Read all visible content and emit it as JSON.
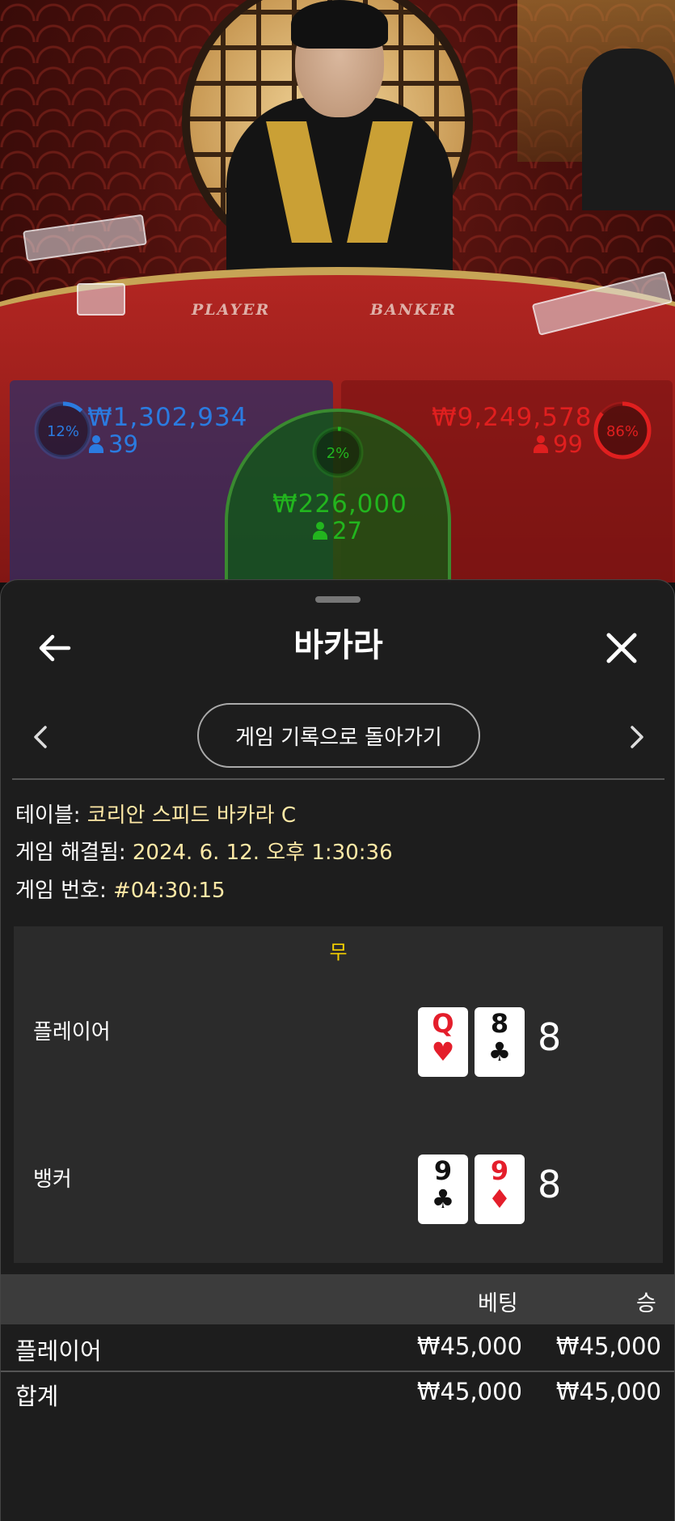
{
  "video": {
    "felt_player": "PLAYER",
    "felt_banker": "BANKER"
  },
  "bets": {
    "player": {
      "percent_label": "12%",
      "percent": 12,
      "amount": "₩1,302,934",
      "players": "39",
      "color": "#2b7be0"
    },
    "tie": {
      "percent_label": "2%",
      "percent": 2,
      "amount": "₩226,000",
      "players": "27",
      "color": "#22b51e"
    },
    "banker": {
      "percent_label": "86%",
      "percent": 86,
      "amount": "₩9,249,578",
      "players": "99",
      "color": "#e01f1f"
    }
  },
  "sheet": {
    "title": "바카라",
    "back_icon": "arrow-left-icon",
    "close_icon": "close-icon",
    "history_button": "게임 기록으로 돌아가기",
    "info": {
      "table_label": "테이블: ",
      "table_value": "코리안 스피드 바카라 C",
      "resolved_label": "게임 해결됨: ",
      "resolved_value": "2024. 6. 12. 오후 1:30:36",
      "number_label": "게임 번호: ",
      "number_value": "#04:30:15"
    },
    "result": {
      "outcome": "무",
      "player": {
        "label": "플레이어",
        "cards": [
          {
            "rank": "Q",
            "suit": "♥",
            "color": "red"
          },
          {
            "rank": "8",
            "suit": "♣",
            "color": "black"
          }
        ],
        "score": "8"
      },
      "banker": {
        "label": "뱅커",
        "cards": [
          {
            "rank": "9",
            "suit": "♣",
            "color": "black"
          },
          {
            "rank": "9",
            "suit": "♦",
            "color": "red"
          }
        ],
        "score": "8"
      }
    },
    "table": {
      "header_bet": "베팅",
      "header_win": "승",
      "rows": [
        {
          "label": "플레이어",
          "bet": "₩45,000",
          "win": "₩45,000"
        }
      ],
      "total": {
        "label": "합계",
        "bet": "₩45,000",
        "win": "₩45,000"
      }
    }
  }
}
